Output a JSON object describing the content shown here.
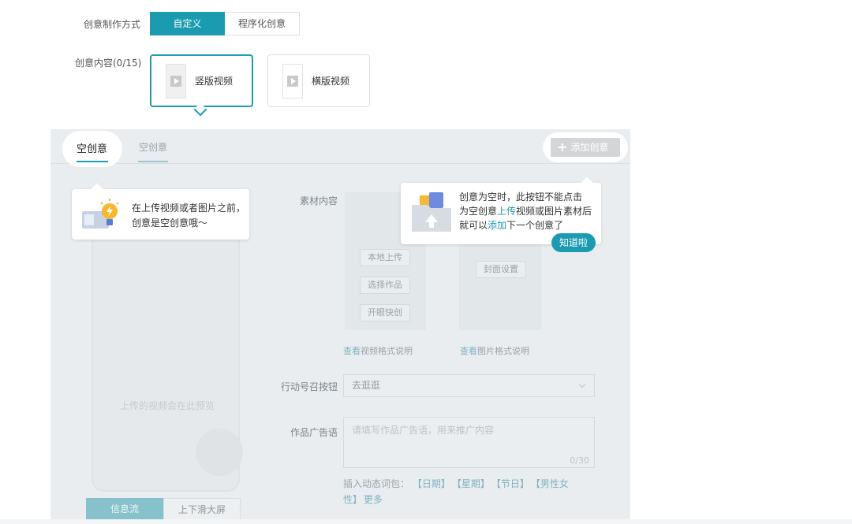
{
  "form": {
    "mode_label": "创意制作方式",
    "mode_options": [
      "自定义",
      "程序化创意"
    ],
    "content_label": "创意内容(0/15)",
    "ratio_cards": [
      "竖版视频",
      "横版视频"
    ]
  },
  "panel": {
    "tabs": [
      "空创意",
      "空创意"
    ],
    "add_button": "添加创意",
    "phone_placeholder": "上传的视频会在此预览",
    "phone_modes": [
      "信息流",
      "上下滑大屏"
    ],
    "material_label": "素材内容",
    "material_buttons": [
      "本地上传",
      "选择作品",
      "开眼快创"
    ],
    "cover_button": "封面设置",
    "video_link_prefix": "查看",
    "video_link_rest": "视频格式说明",
    "image_link_prefix": "查看",
    "image_link_rest": "图片格式说明",
    "cta_label": "行动号召按钮",
    "cta_value": "去逛逛",
    "adtext_label": "作品广告语",
    "adtext_placeholder": "请填写作品广告语，用来推广内容",
    "adtext_count": "0/30",
    "dynamic_prefix": "插入动态词包：",
    "dynamic_tags": [
      "【日期】",
      "【星期】",
      "【节日】",
      "【男性女",
      "性】"
    ],
    "dynamic_more": "更多"
  },
  "tooltips": {
    "left_line1": "在上传视频或者图片之前，",
    "left_line2": "创意是空创意哦～",
    "right_line1": "创意为空时，此按钮不能点击",
    "right_line2_a": "为空创意",
    "right_line2_hl": "上传",
    "right_line2_b": "视频或图片素材后",
    "right_line3_a": "就可以",
    "right_line3_hl": "添加",
    "right_line3_b": "下一个创意了",
    "got_it": "知道啦"
  },
  "colors": {
    "accent": "#1b9bb0",
    "overlay": "#e9edf0"
  }
}
